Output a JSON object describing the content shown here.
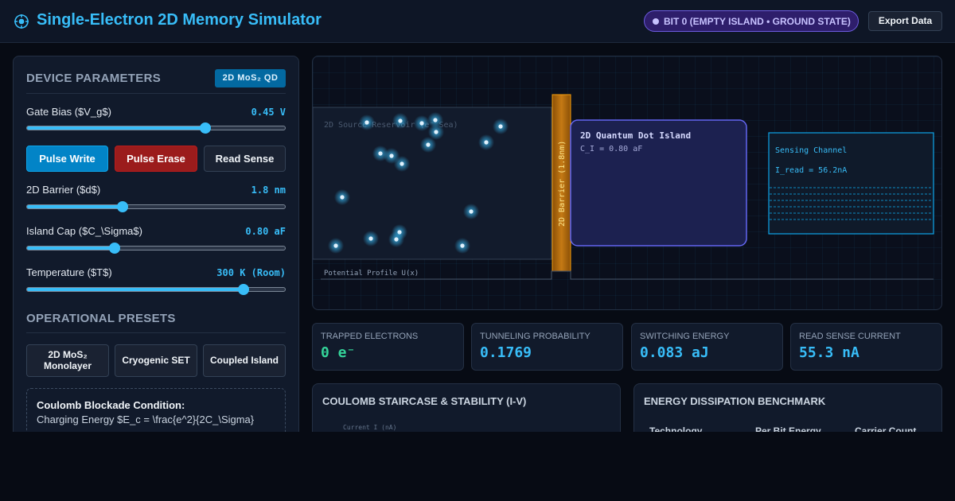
{
  "header": {
    "title": "Single-Electron 2D Memory Simulator",
    "state_badge": "BIT 0 (EMPTY ISLAND • GROUND STATE)",
    "export_label": "Export Data"
  },
  "device_parameters": {
    "title": "DEVICE PARAMETERS",
    "badge": "2D MoS₂ QD",
    "gate_bias": {
      "label": "Gate Bias ($V_g$)",
      "value": "0.45 V",
      "level": 0.69
    },
    "buttons": {
      "write": "Pulse Write",
      "erase": "Pulse Erase",
      "read": "Read Sense"
    },
    "barrier": {
      "label": "2D Barrier ($d$)",
      "value": "1.8 nm",
      "level": 0.37
    },
    "island_cap": {
      "label": "Island Cap ($C_\\Sigma$)",
      "value": "0.80 aF",
      "level": 0.34
    },
    "temperature": {
      "label": "Temperature ($T$)",
      "value": "300 K (Room)",
      "level": 0.84
    }
  },
  "presets": {
    "title": "OPERATIONAL PRESETS",
    "items": [
      "2D MoS₂ Monolayer",
      "Cryogenic SET",
      "Coupled Island"
    ]
  },
  "condition": {
    "title": "Coulomb Blockade Condition:",
    "text": "Charging Energy $E_c = \\frac{e^2}{2C_\\Sigma}"
  },
  "simulation": {
    "reservoir_label": "2D Source Reservoir (e⁻ Sea)",
    "barrier_label": "2D Barrier (1.8nm)",
    "island_title": "2D Quantum Dot Island",
    "island_cap": "C_I = 0.80 aF",
    "sensing_title": "Sensing Channel",
    "sensing_current": "I_read = 56.2nA",
    "potential_label": "Potential Profile U(x)"
  },
  "stats": [
    {
      "label": "TRAPPED ELECTRONS",
      "value": "0 e⁻"
    },
    {
      "label": "TUNNELING PROBABILITY",
      "value": "0.1769"
    },
    {
      "label": "SWITCHING ENERGY",
      "value": "0.083 aJ"
    },
    {
      "label": "READ SENSE CURRENT",
      "value": "55.3 nA"
    }
  ],
  "staircase": {
    "title": "COULOMB STAIRCASE & STABILITY (I-V)",
    "axis_label": "Current I (nA)"
  },
  "benchmark": {
    "title": "ENERGY DISSIPATION BENCHMARK",
    "columns": [
      "Technology",
      "Per Bit Energy",
      "Carrier Count"
    ]
  },
  "colors": {
    "accent": "#38bdf8",
    "write": "#0284c7",
    "erase": "#9b1c1c",
    "barrier": "#b86e0c",
    "island": "#6366f1",
    "badge": "#2e1e6b",
    "trapped": "#34d399"
  }
}
